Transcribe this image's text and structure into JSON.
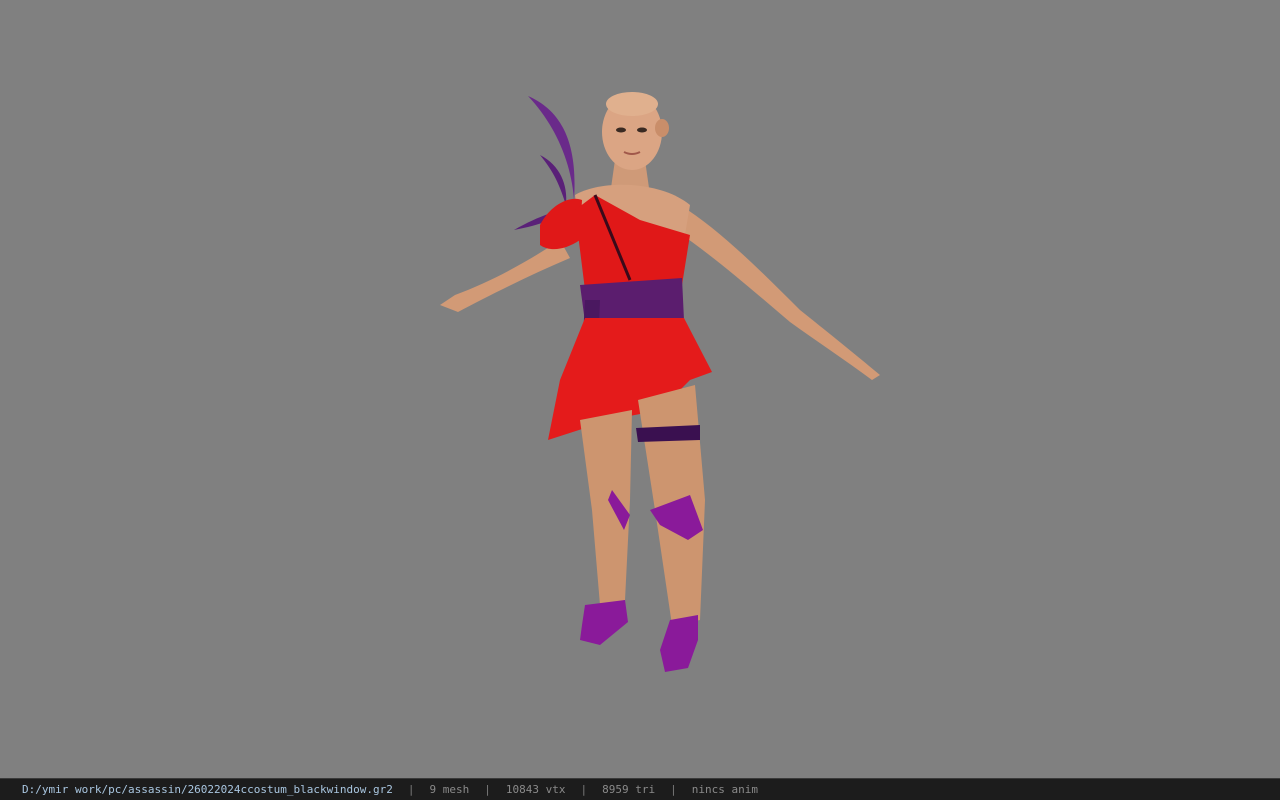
{
  "viewport": {
    "background": "#808080",
    "model": "3D character model"
  },
  "status": {
    "path": "D:/ymir work/pc/assassin/26022024ccostum_blackwindow.gr2",
    "separator": "|",
    "meshes": "9 mesh",
    "vertices": "10843 vtx",
    "triangles": "8959 tri",
    "animation": "nincs anim"
  },
  "colors": {
    "skin": "#d9a07a",
    "dress": "#e01818",
    "sash": "#5b1d6e",
    "shoes": "#8a1a9a"
  }
}
